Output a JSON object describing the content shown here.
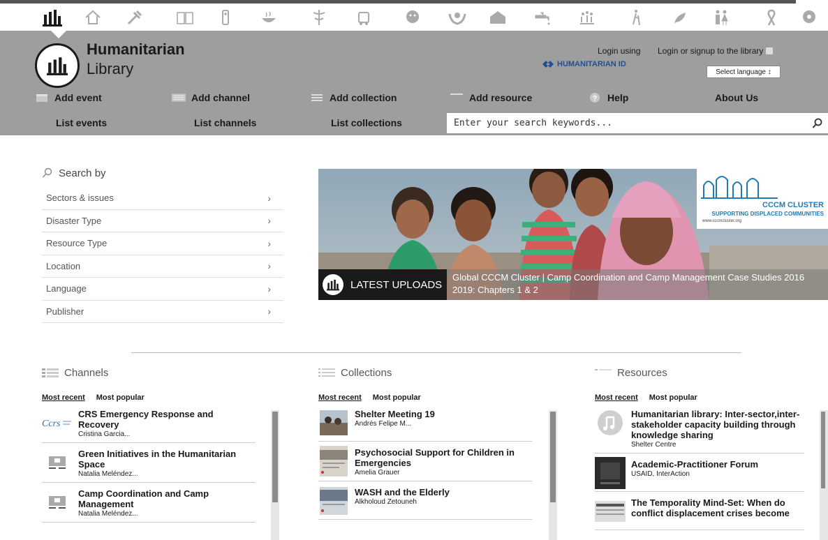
{
  "icon_bar": {
    "icons": [
      "library-icon",
      "shelter-icon",
      "tools-icon",
      "education-icon",
      "health-icon",
      "food-icon",
      "medical-icon",
      "logistics-icon",
      "nutrition-icon",
      "protection-icon",
      "camp-icon",
      "water-icon",
      "population-icon",
      "elderly-icon",
      "environment-icon",
      "gender-icon",
      "hiv-icon",
      "mental-health-icon"
    ]
  },
  "header": {
    "logo_title": "Humanitarian",
    "logo_subtitle": "Library",
    "login_using": "Login using",
    "humanitarian_id": "HUMANITARIAN ID",
    "login_signup": "Login or signup to the library",
    "language_select": "Select language ↕"
  },
  "nav": {
    "row1": [
      {
        "label": "Add event",
        "icon": "calendar-icon"
      },
      {
        "label": "Add channel",
        "icon": "channel-list-icon"
      },
      {
        "label": "Add collection",
        "icon": "collection-list-icon"
      },
      {
        "label": "Add resource",
        "icon": "resource-icon"
      },
      {
        "label": "Help",
        "icon": "help-icon"
      },
      {
        "label": "About Us",
        "icon": ""
      }
    ],
    "row2": [
      {
        "label": "List events"
      },
      {
        "label": "List channels"
      },
      {
        "label": "List collections"
      }
    ],
    "search_placeholder": "Enter your search keywords..."
  },
  "search_by": {
    "title": "Search by",
    "filters": [
      "Sectors & issues",
      "Disaster Type",
      "Resource Type",
      "Location",
      "Language",
      "Publisher"
    ]
  },
  "banner": {
    "label": "LATEST UPLOADS",
    "caption": "Global CCCM Cluster  | Camp Coordination and Camp Management Case Studies 2016 2019: Chapters 1 & 2",
    "partner_name": "CCCM CLUSTER",
    "partner_tagline": "SUPPORTING DISPLACED COMMUNITIES",
    "partner_url": "www.cccmcluster.org"
  },
  "columns": [
    {
      "title": "Channels",
      "tabs": [
        "Most recent",
        "Most popular"
      ],
      "items": [
        {
          "title": "CRS Emergency Response and Recovery",
          "author": "Cristina Garcia..."
        },
        {
          "title": "Green Initiatives in the Humanitarian Space",
          "author": "Natalia Meléndez..."
        },
        {
          "title": "Camp Coordination and Camp Management",
          "author": "Natalia Meléndez..."
        }
      ]
    },
    {
      "title": "Collections",
      "tabs": [
        "Most recent",
        "Most popular"
      ],
      "items": [
        {
          "title": "Shelter Meeting 19",
          "author": "Andrés Felipe M..."
        },
        {
          "title": "Psychosocial Support for Children in Emergencies",
          "author": "Amelia Grauer"
        },
        {
          "title": "WASH and the Elderly",
          "author": "Alkholoud Zetouneh"
        }
      ]
    },
    {
      "title": "Resources",
      "tabs": [
        "Most recent",
        "Most popular"
      ],
      "items": [
        {
          "title": "Humanitarian library: Inter-sector,inter-stakeholder capacity building through knowledge sharing",
          "author": "Shelter Centre"
        },
        {
          "title": "Academic-Practitioner Forum",
          "author": "USAID, InterAction"
        },
        {
          "title": "The Temporality Mind-Set: When do conflict displacement crises become",
          "author": ""
        }
      ]
    }
  ]
}
